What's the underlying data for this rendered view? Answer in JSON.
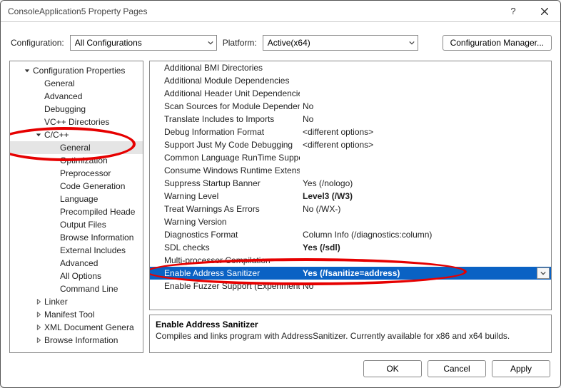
{
  "window": {
    "title": "ConsoleApplication5 Property Pages"
  },
  "toolbar": {
    "configLabel": "Configuration:",
    "configValue": "All Configurations",
    "platformLabel": "Platform:",
    "platformValue": "Active(x64)",
    "cfgManager": "Configuration Manager..."
  },
  "tree": [
    {
      "d": 1,
      "tw": "open",
      "label": "Configuration Properties"
    },
    {
      "d": 2,
      "tw": "",
      "label": "General"
    },
    {
      "d": 2,
      "tw": "",
      "label": "Advanced"
    },
    {
      "d": 2,
      "tw": "",
      "label": "Debugging"
    },
    {
      "d": 2,
      "tw": "",
      "label": "VC++ Directories"
    },
    {
      "d": 2,
      "tw": "open",
      "label": "C/C++"
    },
    {
      "d": 3,
      "tw": "",
      "label": "General",
      "sel": true
    },
    {
      "d": 3,
      "tw": "",
      "label": "Optimization"
    },
    {
      "d": 3,
      "tw": "",
      "label": "Preprocessor"
    },
    {
      "d": 3,
      "tw": "",
      "label": "Code Generation"
    },
    {
      "d": 3,
      "tw": "",
      "label": "Language"
    },
    {
      "d": 3,
      "tw": "",
      "label": "Precompiled Heade"
    },
    {
      "d": 3,
      "tw": "",
      "label": "Output Files"
    },
    {
      "d": 3,
      "tw": "",
      "label": "Browse Information"
    },
    {
      "d": 3,
      "tw": "",
      "label": "External Includes"
    },
    {
      "d": 3,
      "tw": "",
      "label": "Advanced"
    },
    {
      "d": 3,
      "tw": "",
      "label": "All Options"
    },
    {
      "d": 3,
      "tw": "",
      "label": "Command Line"
    },
    {
      "d": 2,
      "tw": "closed",
      "label": "Linker"
    },
    {
      "d": 2,
      "tw": "closed",
      "label": "Manifest Tool"
    },
    {
      "d": 2,
      "tw": "closed",
      "label": "XML Document Genera"
    },
    {
      "d": 2,
      "tw": "closed",
      "label": "Browse Information"
    }
  ],
  "grid": [
    {
      "name": "Additional BMI Directories",
      "value": ""
    },
    {
      "name": "Additional Module Dependencies",
      "value": ""
    },
    {
      "name": "Additional Header Unit Dependencies",
      "value": ""
    },
    {
      "name": "Scan Sources for Module Dependencies",
      "value": "No"
    },
    {
      "name": "Translate Includes to Imports",
      "value": "No"
    },
    {
      "name": "Debug Information Format",
      "value": "<different options>"
    },
    {
      "name": "Support Just My Code Debugging",
      "value": "<different options>"
    },
    {
      "name": "Common Language RunTime Support",
      "value": ""
    },
    {
      "name": "Consume Windows Runtime Extension",
      "value": ""
    },
    {
      "name": "Suppress Startup Banner",
      "value": "Yes (/nologo)"
    },
    {
      "name": "Warning Level",
      "value": "Level3 (/W3)",
      "bold": true
    },
    {
      "name": "Treat Warnings As Errors",
      "value": "No (/WX-)"
    },
    {
      "name": "Warning Version",
      "value": ""
    },
    {
      "name": "Diagnostics Format",
      "value": "Column Info (/diagnostics:column)"
    },
    {
      "name": "SDL checks",
      "value": "Yes (/sdl)",
      "bold": true
    },
    {
      "name": "Multi-processor Compilation",
      "value": ""
    },
    {
      "name": "Enable Address Sanitizer",
      "value": "Yes (/fsanitize=address)",
      "sel": true,
      "dd": true
    },
    {
      "name": "Enable Fuzzer Support (Experimental)",
      "value": "No"
    }
  ],
  "desc": {
    "title": "Enable Address Sanitizer",
    "text": "Compiles and links program with AddressSanitizer. Currently available for x86 and x64 builds."
  },
  "buttons": {
    "ok": "OK",
    "cancel": "Cancel",
    "apply": "Apply"
  }
}
